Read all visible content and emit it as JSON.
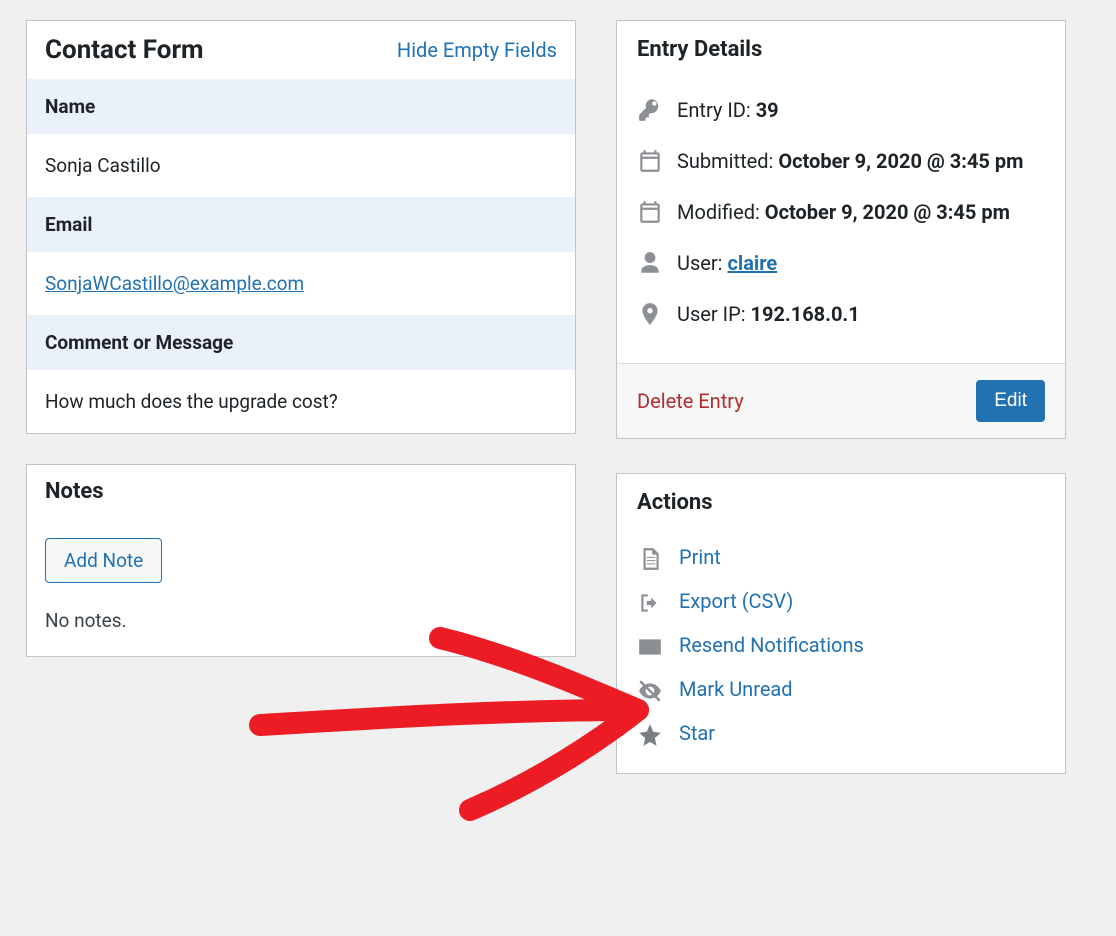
{
  "contactForm": {
    "title": "Contact Form",
    "hideEmpty": "Hide Empty Fields",
    "fields": {
      "nameLabel": "Name",
      "nameValue": "Sonja Castillo",
      "emailLabel": "Email",
      "emailValue": "SonjaWCastillo@example.com",
      "commentLabel": "Comment or Message",
      "commentValue": "How much does the upgrade cost?"
    }
  },
  "notes": {
    "title": "Notes",
    "addNote": "Add Note",
    "empty": "No notes."
  },
  "entryDetails": {
    "title": "Entry Details",
    "entryIdLabel": "Entry ID: ",
    "entryIdValue": "39",
    "submittedLabel": "Submitted: ",
    "submittedValue": "October 9, 2020 @ 3:45 pm",
    "modifiedLabel": "Modified: ",
    "modifiedValue": "October 9, 2020 @ 3:45 pm",
    "userLabel": "User: ",
    "userValue": "claire",
    "userIpLabel": "User IP: ",
    "userIpValue": "192.168.0.1",
    "delete": "Delete Entry",
    "edit": "Edit"
  },
  "actions": {
    "title": "Actions",
    "print": "Print",
    "export": "Export (CSV)",
    "resend": "Resend Notifications",
    "markUnread": "Mark Unread",
    "star": "Star"
  }
}
